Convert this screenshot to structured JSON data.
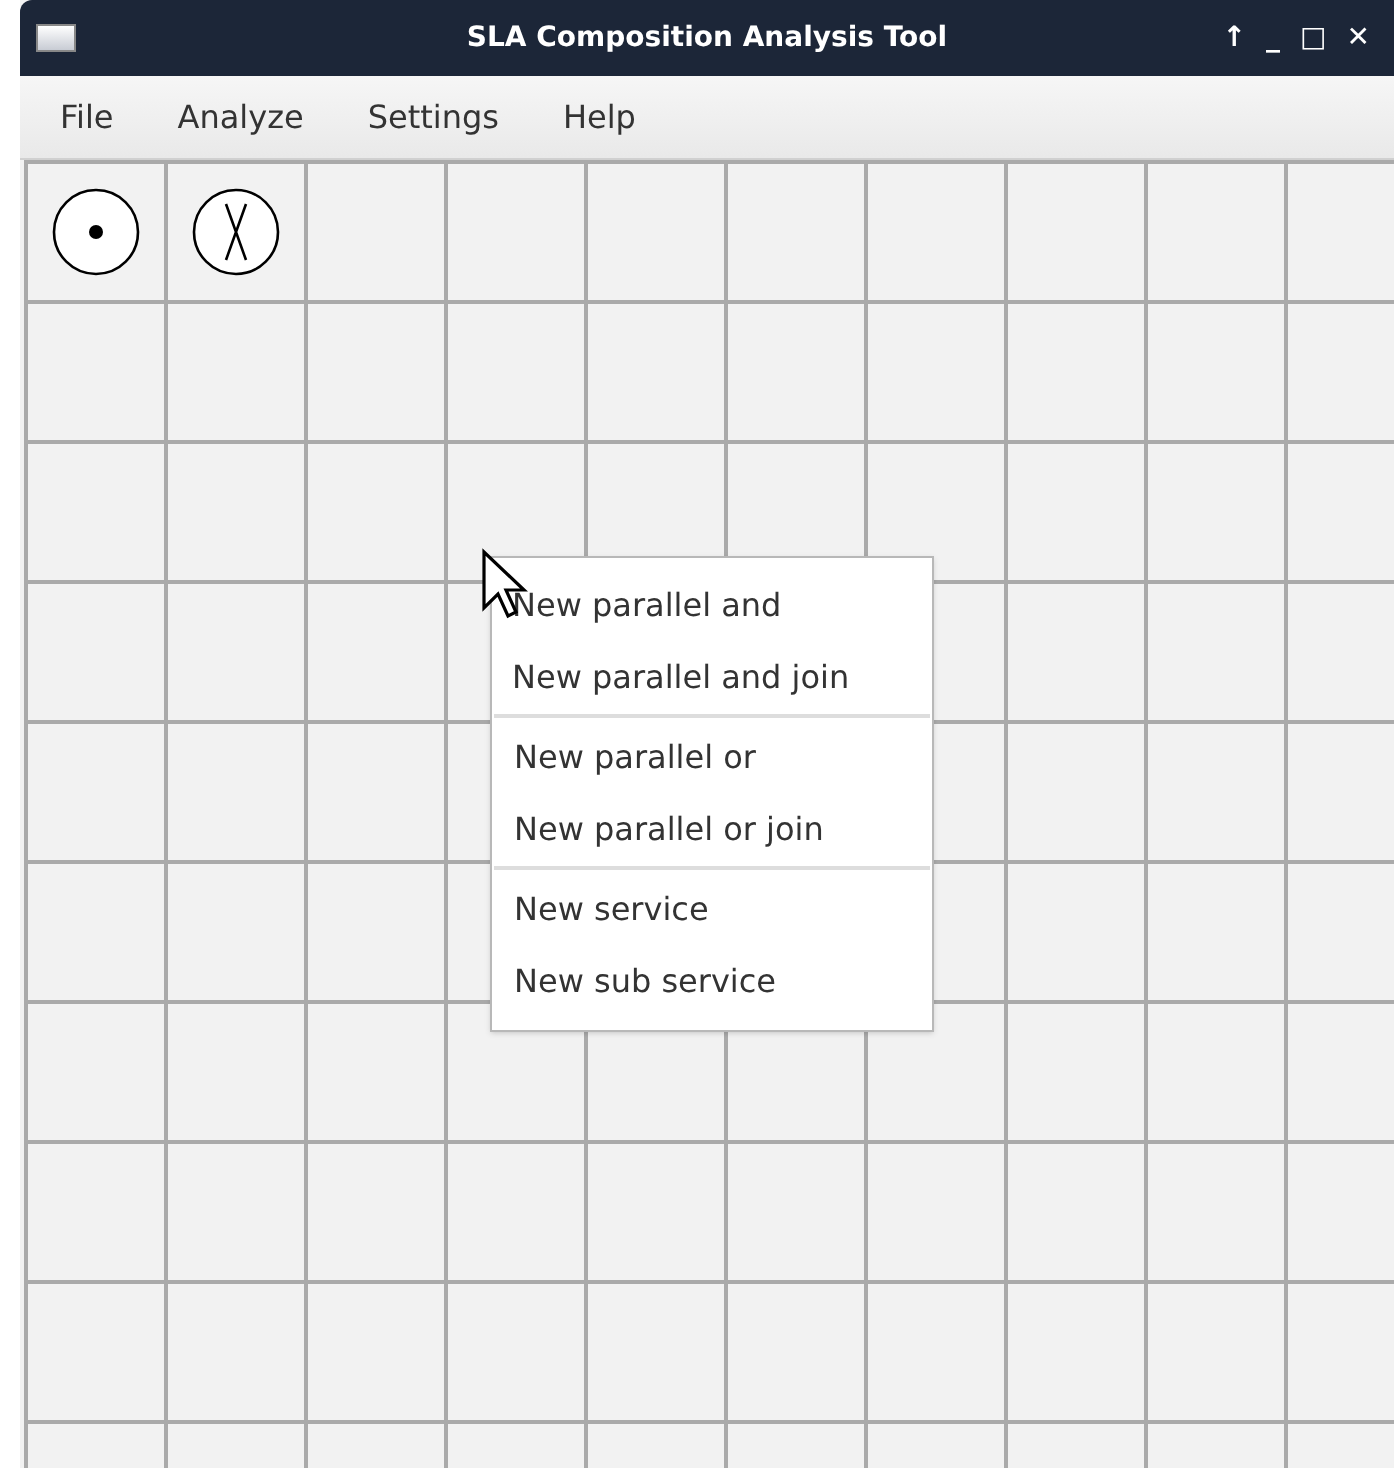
{
  "window": {
    "title": "SLA Composition Analysis Tool",
    "controls": [
      "↑",
      "_",
      "□",
      "✕"
    ]
  },
  "menu_bar": [
    "File",
    "Analyze",
    "Settings",
    "Help"
  ],
  "context_menu": {
    "groups": [
      [
        "New parallel and",
        "New parallel and join"
      ],
      [
        "New parallel or",
        "New parallel or join"
      ],
      [
        "New service",
        "New sub service"
      ]
    ]
  }
}
